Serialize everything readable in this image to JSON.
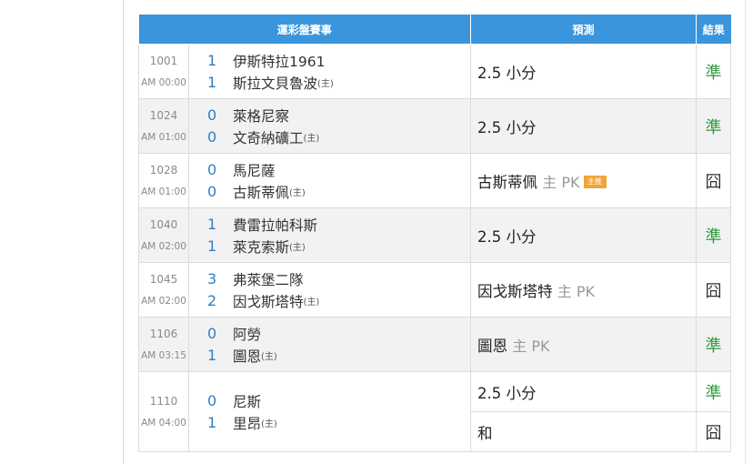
{
  "header": {
    "match": "運彩盤賽事",
    "prediction": "預測",
    "result": "結果"
  },
  "home_tag": "(主)",
  "rows": [
    {
      "id": "1001",
      "time": "AM 00:00",
      "away_score": "1",
      "away": "伊斯特拉1961",
      "home_score": "1",
      "home": "斯拉文貝魯波",
      "predictions": [
        {
          "pick": "2.5 小分",
          "tag": "",
          "badge": "",
          "result": "準",
          "result_color": "#2e9a3c"
        }
      ]
    },
    {
      "id": "1024",
      "time": "AM 01:00",
      "away_score": "0",
      "away": "萊格尼察",
      "home_score": "0",
      "home": "文奇納礦工",
      "predictions": [
        {
          "pick": "2.5 小分",
          "tag": "",
          "badge": "",
          "result": "準",
          "result_color": "#2e9a3c"
        }
      ]
    },
    {
      "id": "1028",
      "time": "AM 01:00",
      "away_score": "0",
      "away": "馬尼薩",
      "home_score": "0",
      "home": "古斯蒂佩",
      "predictions": [
        {
          "pick": "古斯蒂佩",
          "tag": "主 PK",
          "badge": "主推",
          "result": "囧",
          "result_color": "#333333"
        }
      ]
    },
    {
      "id": "1040",
      "time": "AM 02:00",
      "away_score": "1",
      "away": "費雷拉帕科斯",
      "home_score": "1",
      "home": "萊克索斯",
      "predictions": [
        {
          "pick": "2.5 小分",
          "tag": "",
          "badge": "",
          "result": "準",
          "result_color": "#2e9a3c"
        }
      ]
    },
    {
      "id": "1045",
      "time": "AM 02:00",
      "away_score": "3",
      "away": "弗萊堡二隊",
      "home_score": "2",
      "home": "因戈斯塔特",
      "predictions": [
        {
          "pick": "因戈斯塔特",
          "tag": "主 PK",
          "badge": "",
          "result": "囧",
          "result_color": "#333333"
        }
      ]
    },
    {
      "id": "1106",
      "time": "AM 03:15",
      "away_score": "0",
      "away": "阿勞",
      "home_score": "1",
      "home": "圖恩",
      "predictions": [
        {
          "pick": "圖恩",
          "tag": "主 PK",
          "badge": "",
          "result": "準",
          "result_color": "#2e9a3c"
        }
      ]
    },
    {
      "id": "1110",
      "time": "AM 04:00",
      "away_score": "0",
      "away": "尼斯",
      "home_score": "1",
      "home": "里昂",
      "predictions": [
        {
          "pick": "2.5 小分",
          "tag": "",
          "badge": "",
          "result": "準",
          "result_color": "#2e9a3c"
        },
        {
          "pick": "和",
          "tag": "",
          "badge": "",
          "result": "囧",
          "result_color": "#333333"
        }
      ]
    }
  ]
}
